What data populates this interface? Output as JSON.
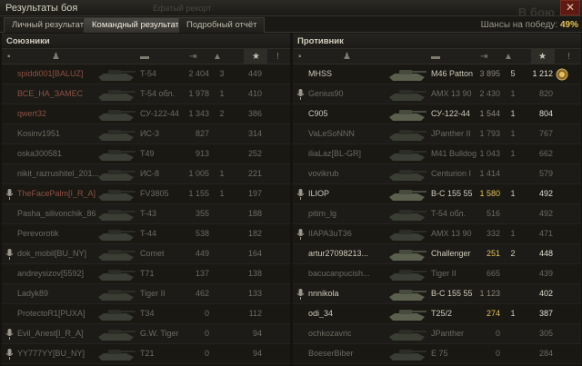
{
  "window": {
    "title": "Результаты боя",
    "ghost_title_tail": "Ефатый рекорт",
    "ghost_right": "В бою"
  },
  "tabs": [
    {
      "label": "Личный результат",
      "active": false
    },
    {
      "label": "Командный результат",
      "active": true
    },
    {
      "label": "Подробный отчёт",
      "active": false
    }
  ],
  "chance": {
    "label": "Шансы на победу:",
    "value": "49%"
  },
  "allies": {
    "title": "Союзники",
    "rows": [
      {
        "name": "spiddi001[BALUZ]",
        "vehicle": "T-54",
        "damage": "2 404",
        "kills": "3",
        "xp": "449",
        "dead": true,
        "red": true,
        "mic": false
      },
      {
        "name": "ВСЕ_НА_ЗАМЕС",
        "vehicle": "T-54 обл.",
        "damage": "1 978",
        "kills": "1",
        "xp": "410",
        "dead": true,
        "red": true,
        "mic": false
      },
      {
        "name": "qwert32",
        "vehicle": "СУ-122-44",
        "damage": "1 343",
        "kills": "2",
        "xp": "386",
        "dead": true,
        "red": true,
        "mic": false
      },
      {
        "name": "Kosinv1951",
        "vehicle": "ИС-3",
        "damage": "827",
        "kills": "",
        "xp": "314",
        "dead": true,
        "red": false,
        "mic": false
      },
      {
        "name": "oska300581",
        "vehicle": "T49",
        "damage": "913",
        "kills": "",
        "xp": "252",
        "dead": true,
        "red": false,
        "mic": false
      },
      {
        "name": "nikit_razrushitel_201...",
        "vehicle": "ИС-8",
        "damage": "1 005",
        "kills": "1",
        "xp": "221",
        "dead": true,
        "red": false,
        "mic": false
      },
      {
        "name": "TheFacePalm[I_R_A]",
        "vehicle": "FV3805",
        "damage": "1 155",
        "kills": "1",
        "xp": "197",
        "dead": true,
        "red": true,
        "mic": true
      },
      {
        "name": "Pasha_silivonchik_86",
        "vehicle": "T-43",
        "damage": "355",
        "kills": "",
        "xp": "188",
        "dead": true,
        "red": false,
        "mic": false
      },
      {
        "name": "Perevorotik",
        "vehicle": "T-44",
        "damage": "538",
        "kills": "",
        "xp": "182",
        "dead": true,
        "red": false,
        "mic": false
      },
      {
        "name": "dok_mobil[BU_NY]",
        "vehicle": "Comet",
        "damage": "449",
        "kills": "",
        "xp": "164",
        "dead": true,
        "red": false,
        "mic": true
      },
      {
        "name": "andreysizov[5592]",
        "vehicle": "T71",
        "damage": "137",
        "kills": "",
        "xp": "138",
        "dead": true,
        "red": false,
        "mic": false
      },
      {
        "name": "Ladyk89",
        "vehicle": "Tiger II",
        "damage": "462",
        "kills": "",
        "xp": "133",
        "dead": true,
        "red": false,
        "mic": false
      },
      {
        "name": "ProtectoR1[PUXA]",
        "vehicle": "T34",
        "damage": "0",
        "kills": "",
        "xp": "112",
        "dead": true,
        "red": false,
        "mic": false
      },
      {
        "name": "Evil_Anest[I_R_A]",
        "vehicle": "G.W. Tiger",
        "damage": "0",
        "kills": "",
        "xp": "94",
        "dead": true,
        "red": false,
        "mic": true
      },
      {
        "name": "YY777YY[BU_NY]",
        "vehicle": "T21",
        "damage": "0",
        "kills": "",
        "xp": "94",
        "dead": true,
        "red": false,
        "mic": true
      }
    ]
  },
  "enemies": {
    "title": "Противник",
    "rows": [
      {
        "name": "MHSS",
        "vehicle": "M46 Patton",
        "damage": "3 895",
        "kills": "5",
        "xp": "1 212",
        "dead": false,
        "mic": false,
        "badge": true
      },
      {
        "name": "Genius90",
        "vehicle": "AMX 13 90",
        "damage": "2 430",
        "kills": "1",
        "xp": "820",
        "dead": true,
        "mic": true,
        "badge": false
      },
      {
        "name": "C905",
        "vehicle": "СУ-122-44",
        "damage": "1 544",
        "kills": "1",
        "xp": "804",
        "dead": false,
        "mic": false,
        "badge": false
      },
      {
        "name": "VaLeSoNNN",
        "vehicle": "JPanther II",
        "damage": "1 793",
        "kills": "1",
        "xp": "767",
        "dead": true,
        "mic": false,
        "badge": false
      },
      {
        "name": "iliaLaz[BL-GR]",
        "vehicle": "M41 Bulldog",
        "damage": "1 043",
        "kills": "1",
        "xp": "662",
        "dead": true,
        "mic": false,
        "badge": false
      },
      {
        "name": "vovikrub",
        "vehicle": "Centurion I",
        "damage": "1 414",
        "kills": "",
        "xp": "579",
        "dead": true,
        "mic": false,
        "badge": false
      },
      {
        "name": "ILIOP",
        "vehicle": "B-C 155 55",
        "damage": "1 580",
        "kills": "1",
        "xp": "492",
        "dead": false,
        "mic": true,
        "badge": false,
        "hl": true
      },
      {
        "name": "pitim_lg",
        "vehicle": "T-54 обл.",
        "damage": "516",
        "kills": "",
        "xp": "492",
        "dead": true,
        "mic": false,
        "badge": false
      },
      {
        "name": "IIAPA3uT36",
        "vehicle": "AMX 13 90",
        "damage": "332",
        "kills": "1",
        "xp": "471",
        "dead": true,
        "mic": true,
        "badge": false
      },
      {
        "name": "artur27098213...",
        "vehicle": "Challenger",
        "damage": "251",
        "kills": "2",
        "xp": "448",
        "dead": false,
        "mic": false,
        "badge": false,
        "hl": true
      },
      {
        "name": "bacucanpucish...",
        "vehicle": "Tiger II",
        "damage": "665",
        "kills": "",
        "xp": "439",
        "dead": true,
        "mic": false,
        "badge": false
      },
      {
        "name": "nnnikola",
        "vehicle": "B-C 155 55",
        "damage": "1 123",
        "kills": "",
        "xp": "402",
        "dead": false,
        "mic": true,
        "badge": false
      },
      {
        "name": "odi_34",
        "vehicle": "T25/2",
        "damage": "274",
        "kills": "1",
        "xp": "387",
        "dead": false,
        "mic": false,
        "badge": false,
        "hl": true
      },
      {
        "name": "ochkozavric",
        "vehicle": "JPanther",
        "damage": "0",
        "kills": "",
        "xp": "305",
        "dead": true,
        "mic": false,
        "badge": false
      },
      {
        "name": "BoeserBiber",
        "vehicle": "E 75",
        "damage": "0",
        "kills": "",
        "xp": "284",
        "dead": true,
        "mic": false,
        "badge": false
      }
    ]
  },
  "columns": {
    "star": "★",
    "kills_icon": "!"
  },
  "colors": {
    "gold": "#e6c35a",
    "dead_red": "#8d5144",
    "panel": "#16150f"
  }
}
